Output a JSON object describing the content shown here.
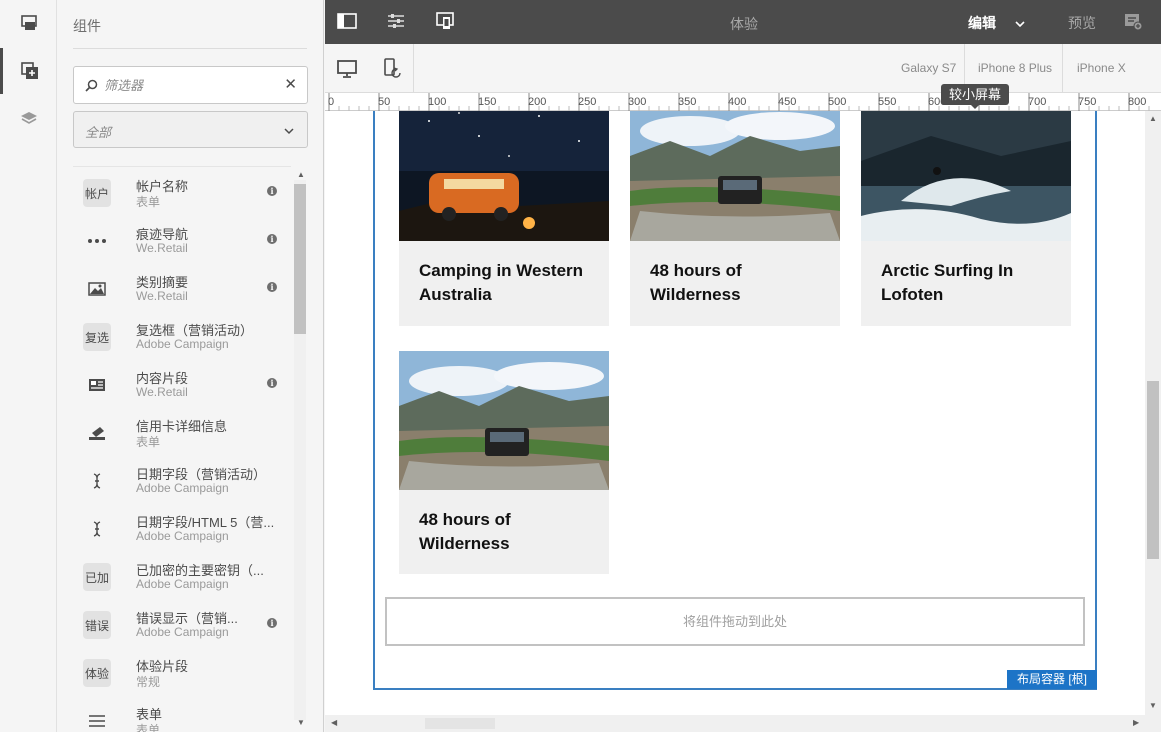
{
  "rail": {
    "icons": [
      "page-panel-icon",
      "components-icon",
      "layers-icon"
    ]
  },
  "sidebar": {
    "title": "组件",
    "filter_placeholder": "筛选器",
    "group_select": "全部",
    "items": [
      {
        "name": "帐户名称",
        "group": "表单",
        "icon": "帐户",
        "info": true
      },
      {
        "name": "痕迹导航",
        "group": "We.Retail",
        "icon": "dots-icon",
        "info": true
      },
      {
        "name": "类别摘要",
        "group": "We.Retail",
        "icon": "image-icon",
        "info": true
      },
      {
        "name": "复选框（营销活动）",
        "group": "Adobe Campaign",
        "icon": "复选",
        "info": false
      },
      {
        "name": "内容片段",
        "group": "We.Retail",
        "icon": "card-icon",
        "info": true
      },
      {
        "name": "信用卡详细信息",
        "group": "表单",
        "icon": "card-stack-icon",
        "info": false
      },
      {
        "name": "日期字段（营销活动）",
        "group": "Adobe Campaign",
        "icon": "text-cursor-icon",
        "info": false
      },
      {
        "name": "日期字段/HTML 5（营...",
        "group": "Adobe Campaign",
        "icon": "text-cursor-icon",
        "info": false
      },
      {
        "name": "已加密的主要密钥（...",
        "group": "Adobe Campaign",
        "icon": "已加",
        "info": false
      },
      {
        "name": "错误显示（营销...",
        "group": "Adobe Campaign",
        "icon": "错误",
        "info": true
      },
      {
        "name": "体验片段",
        "group": "常规",
        "icon": "体验",
        "info": false
      },
      {
        "name": "表单",
        "group": "表单",
        "icon": "lines-icon",
        "info": false
      }
    ]
  },
  "topbar": {
    "center_label": "体验",
    "edit_label": "编辑",
    "preview_label": "预览"
  },
  "emulator": {
    "devices": [
      "Galaxy S7",
      "iPhone 8 Plus",
      "iPhone X"
    ],
    "tooltip": "较小屏幕"
  },
  "ruler": {
    "ticks": [
      "0",
      "50",
      "100",
      "150",
      "200",
      "250",
      "300",
      "350",
      "400",
      "450",
      "500",
      "550",
      "600",
      "650",
      "700",
      "750",
      "800"
    ]
  },
  "content": {
    "cards": [
      {
        "title": "Camping in Western Australia"
      },
      {
        "title": "48 hours of Wilderness"
      },
      {
        "title": "Arctic Surfing In Lofoten"
      },
      {
        "title": "48 hours of Wilderness"
      }
    ],
    "dropzone": "将组件拖动到此处",
    "container_label": "布局容器 [根]"
  },
  "colors": {
    "topbar": "#4b4b4b",
    "container_border": "#3a7fc1",
    "container_label": "#1d74c7"
  }
}
